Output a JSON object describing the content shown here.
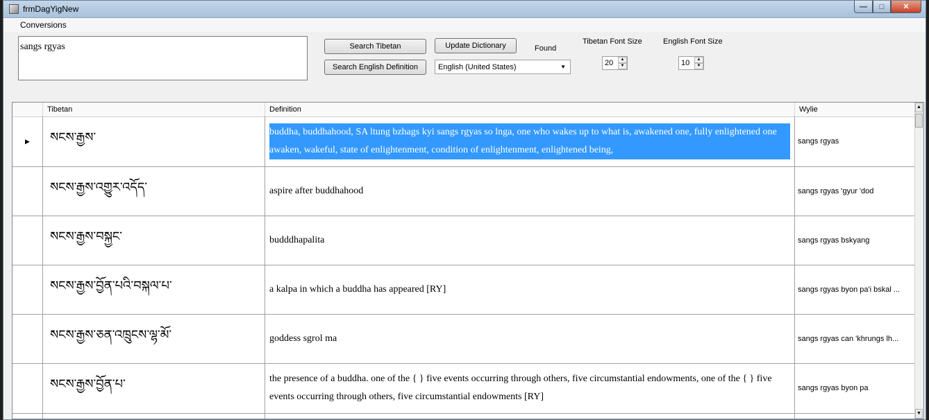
{
  "window": {
    "title": "frmDagYigNew",
    "min_glyph": "—",
    "max_glyph": "□",
    "close_glyph": "✕"
  },
  "menu": {
    "conversions": "Conversions"
  },
  "toolbar": {
    "query": "sangs rgyas",
    "search_tibetan": "Search Tibetan",
    "search_english": "Search English Definition",
    "update_dictionary": "Update Dictionary",
    "found_label": "Found",
    "language": "English (United States)",
    "tibetan_font_size_label": "Tibetan Font Size",
    "tibetan_font_size": "20",
    "english_font_size_label": "English Font Size",
    "english_font_size": "10"
  },
  "grid": {
    "columns": [
      "Tibetan",
      "Definition",
      "Wylie"
    ],
    "current_row_marker": "▶",
    "rows": [
      {
        "tibetan": "སངས་རྒྱས་",
        "definition": "buddha, buddhahood, SA ltung bzhags kyi sangs rgyas so lnga, one who wakes up to what is, awakened one, fully enlightened one awaken, wakeful, state of enlightenment, condition of enlightenment, enlightened being,",
        "wylie": "sangs rgyas"
      },
      {
        "tibetan": "སངས་རྒྱས་འགྱུར་འདོད་",
        "definition": "aspire after buddhahood",
        "wylie": "sangs rgyas 'gyur 'dod"
      },
      {
        "tibetan": "སངས་རྒྱས་བསྐྱང་",
        "definition": "budddhapalita",
        "wylie": "sangs rgyas bskyang"
      },
      {
        "tibetan": "སངས་རྒྱས་བྱོན་པའི་བསྐལ་པ་",
        "definition": "a kalpa in which a buddha has appeared [RY]",
        "wylie": "sangs rgyas byon pa'i bskal ..."
      },
      {
        "tibetan": "སངས་རྒྱས་ཅན་འཁྲུངས་ལྷ་མོ་",
        "definition": "goddess sgrol ma",
        "wylie": "sangs rgyas can 'khrungs lh..."
      },
      {
        "tibetan": "སངས་རྒྱས་བྱོན་པ་",
        "definition": "the presence of a buddha. one of the {  } five events occurring through others, five circumstantial endowments, one of the {  } five events occurring through others, five circumstantial endowments [RY]",
        "wylie": "sangs rgyas byon pa"
      }
    ]
  },
  "scroll": {
    "up_glyph": "▲",
    "down_glyph": "▼"
  }
}
